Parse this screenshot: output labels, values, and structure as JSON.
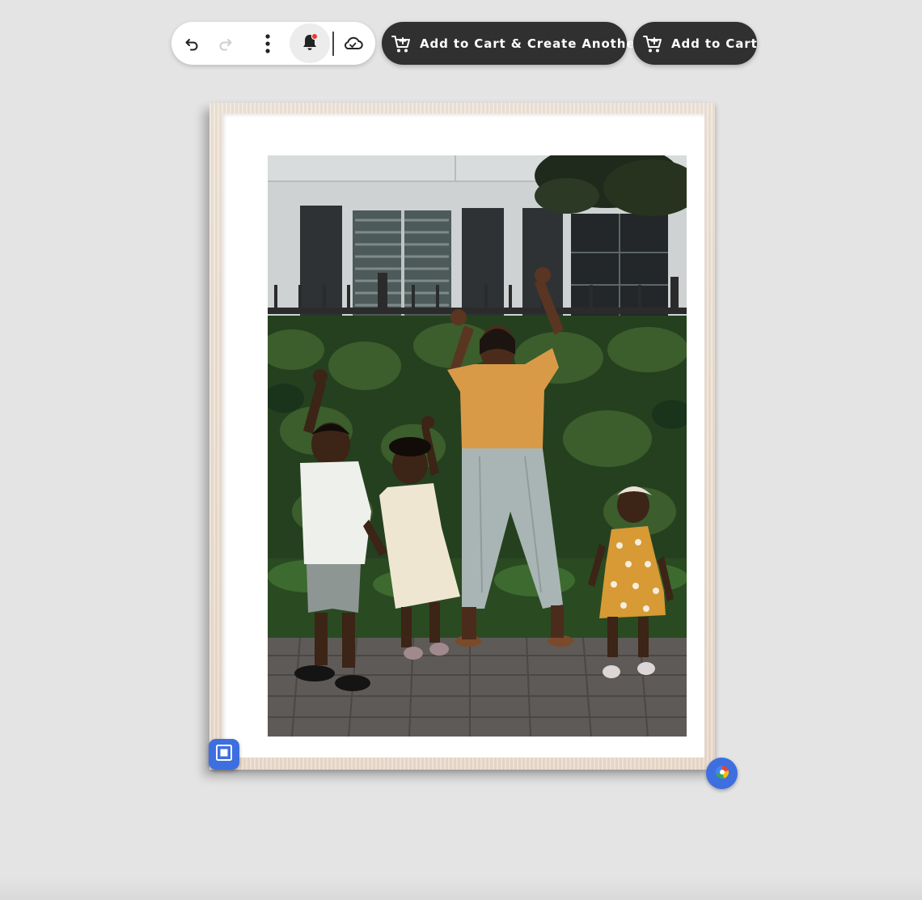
{
  "toolbar": {
    "undo_icon": "undo-icon",
    "redo_icon": "redo-icon",
    "more_icon": "more-vertical-icon",
    "notifications_icon": "bell-icon",
    "notifications_dot_color": "#e53935",
    "cloud_icon": "cloud-save-icon"
  },
  "actions": {
    "create_another_label": "Add to Cart & Create Another",
    "add_to_cart_label": "Add to Cart",
    "cart_icon": "cart-icon",
    "button_color": "#303030"
  },
  "canvas": {
    "frame_style": "light wood frame with white mat",
    "photo_subject": "family photo",
    "photo_alt": "Woman and three children dancing in front of a hedge",
    "bottom_left_badge_icon": "crop-frame-icon",
    "bottom_right_badge_icon": "photo-source-icon",
    "badge_color": "#3e6fe0"
  }
}
